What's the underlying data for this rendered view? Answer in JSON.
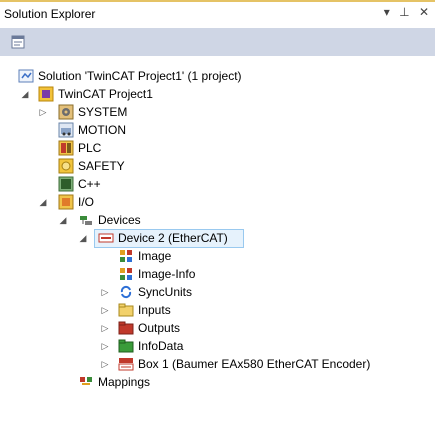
{
  "panel": {
    "title": "Solution Explorer",
    "controls": [
      "▾",
      "⊥",
      "✕"
    ]
  },
  "tree": {
    "solution": "Solution 'TwinCAT Project1' (1 project)",
    "project": "TwinCAT Project1",
    "system": "SYSTEM",
    "motion": "MOTION",
    "plc": "PLC",
    "safety": "SAFETY",
    "cpp": "C++",
    "io": "I/O",
    "devices": "Devices",
    "device2": "Device 2 (EtherCAT)",
    "image": "Image",
    "image_info": "Image-Info",
    "syncunits": "SyncUnits",
    "inputs": "Inputs",
    "outputs": "Outputs",
    "infodata": "InfoData",
    "box1": "Box 1 (Baumer EAx580 EtherCAT Encoder)",
    "mappings": "Mappings"
  }
}
